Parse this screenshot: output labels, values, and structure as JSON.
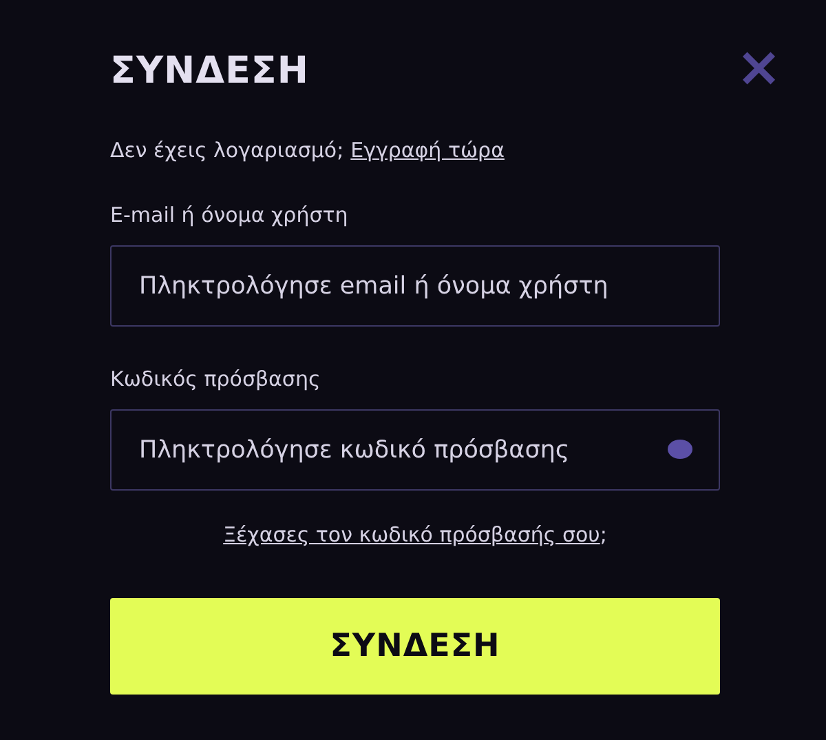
{
  "dialog": {
    "title": "ΣΥΝΔΕΣΗ",
    "close": "×"
  },
  "signup": {
    "prompt": "Δεν έχεις λογαριασμό;",
    "link": "Εγγραφή τώρα"
  },
  "fields": [
    {
      "kind": "text",
      "label": "E-mail ή όνομα χρήστη",
      "placeholder": "Πληκτρολόγησε email ή όνομα χρήστη"
    },
    {
      "kind": "password",
      "label": "Κωδικός πρόσβασης",
      "placeholder": "Πληκτρολόγησε κωδικό πρόσβασης"
    }
  ],
  "forgot": {
    "link": "Ξέχασες τον κωδικό πρόσβασής σου",
    "suffix": ";"
  },
  "submit": "ΣΥΝΔΕΣΗ"
}
